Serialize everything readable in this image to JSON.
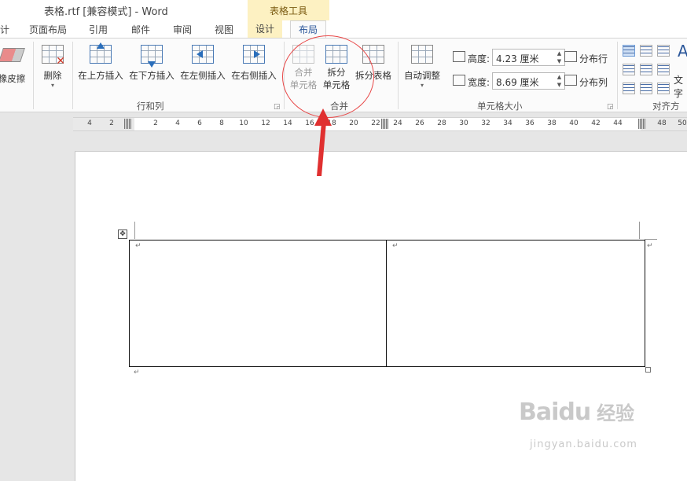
{
  "window": {
    "title": "表格.rtf [兼容模式] - Word"
  },
  "context_group": {
    "label": "表格工具"
  },
  "tabs": {
    "items": [
      {
        "label": "计"
      },
      {
        "label": "页面布局"
      },
      {
        "label": "引用"
      },
      {
        "label": "邮件"
      },
      {
        "label": "审阅"
      },
      {
        "label": "视图"
      },
      {
        "label": "设计"
      },
      {
        "label": "布局"
      }
    ]
  },
  "ribbon": {
    "eraser_label": "橡皮擦",
    "rows_cols": {
      "delete_label": "删除",
      "insert_above": "在上方插入",
      "insert_below": "在下方插入",
      "insert_left": "在左侧插入",
      "insert_right": "在右侧插入",
      "group_label": "行和列"
    },
    "merge": {
      "merge_cells_l1": "合并",
      "merge_cells_l2": "单元格",
      "split_cells_l1": "拆分",
      "split_cells_l2": "单元格",
      "split_table": "拆分表格",
      "group_label": "合并"
    },
    "cell_size": {
      "autofit_label": "自动调整",
      "height_label": "高度:",
      "height_value": "4.23 厘米",
      "width_label": "宽度:",
      "width_value": "8.69 厘米",
      "distribute_rows": "分布行",
      "distribute_cols": "分布列",
      "group_label": "单元格大小"
    },
    "alignment": {
      "text_dir_label": "文字",
      "group_label": "对齐方"
    }
  },
  "ruler": {
    "ticks": [
      "4",
      "2",
      "2",
      "4",
      "6",
      "8",
      "10",
      "12",
      "14",
      "16",
      "18",
      "20",
      "22",
      "24",
      "26",
      "28",
      "30",
      "32",
      "34",
      "36",
      "38",
      "40",
      "42",
      "44",
      "48",
      "50"
    ]
  },
  "document": {
    "para_mark": "↵"
  },
  "watermark": {
    "brand": "Baidu",
    "brand_cn": "经验",
    "url": "jingyan.baidu.com"
  }
}
